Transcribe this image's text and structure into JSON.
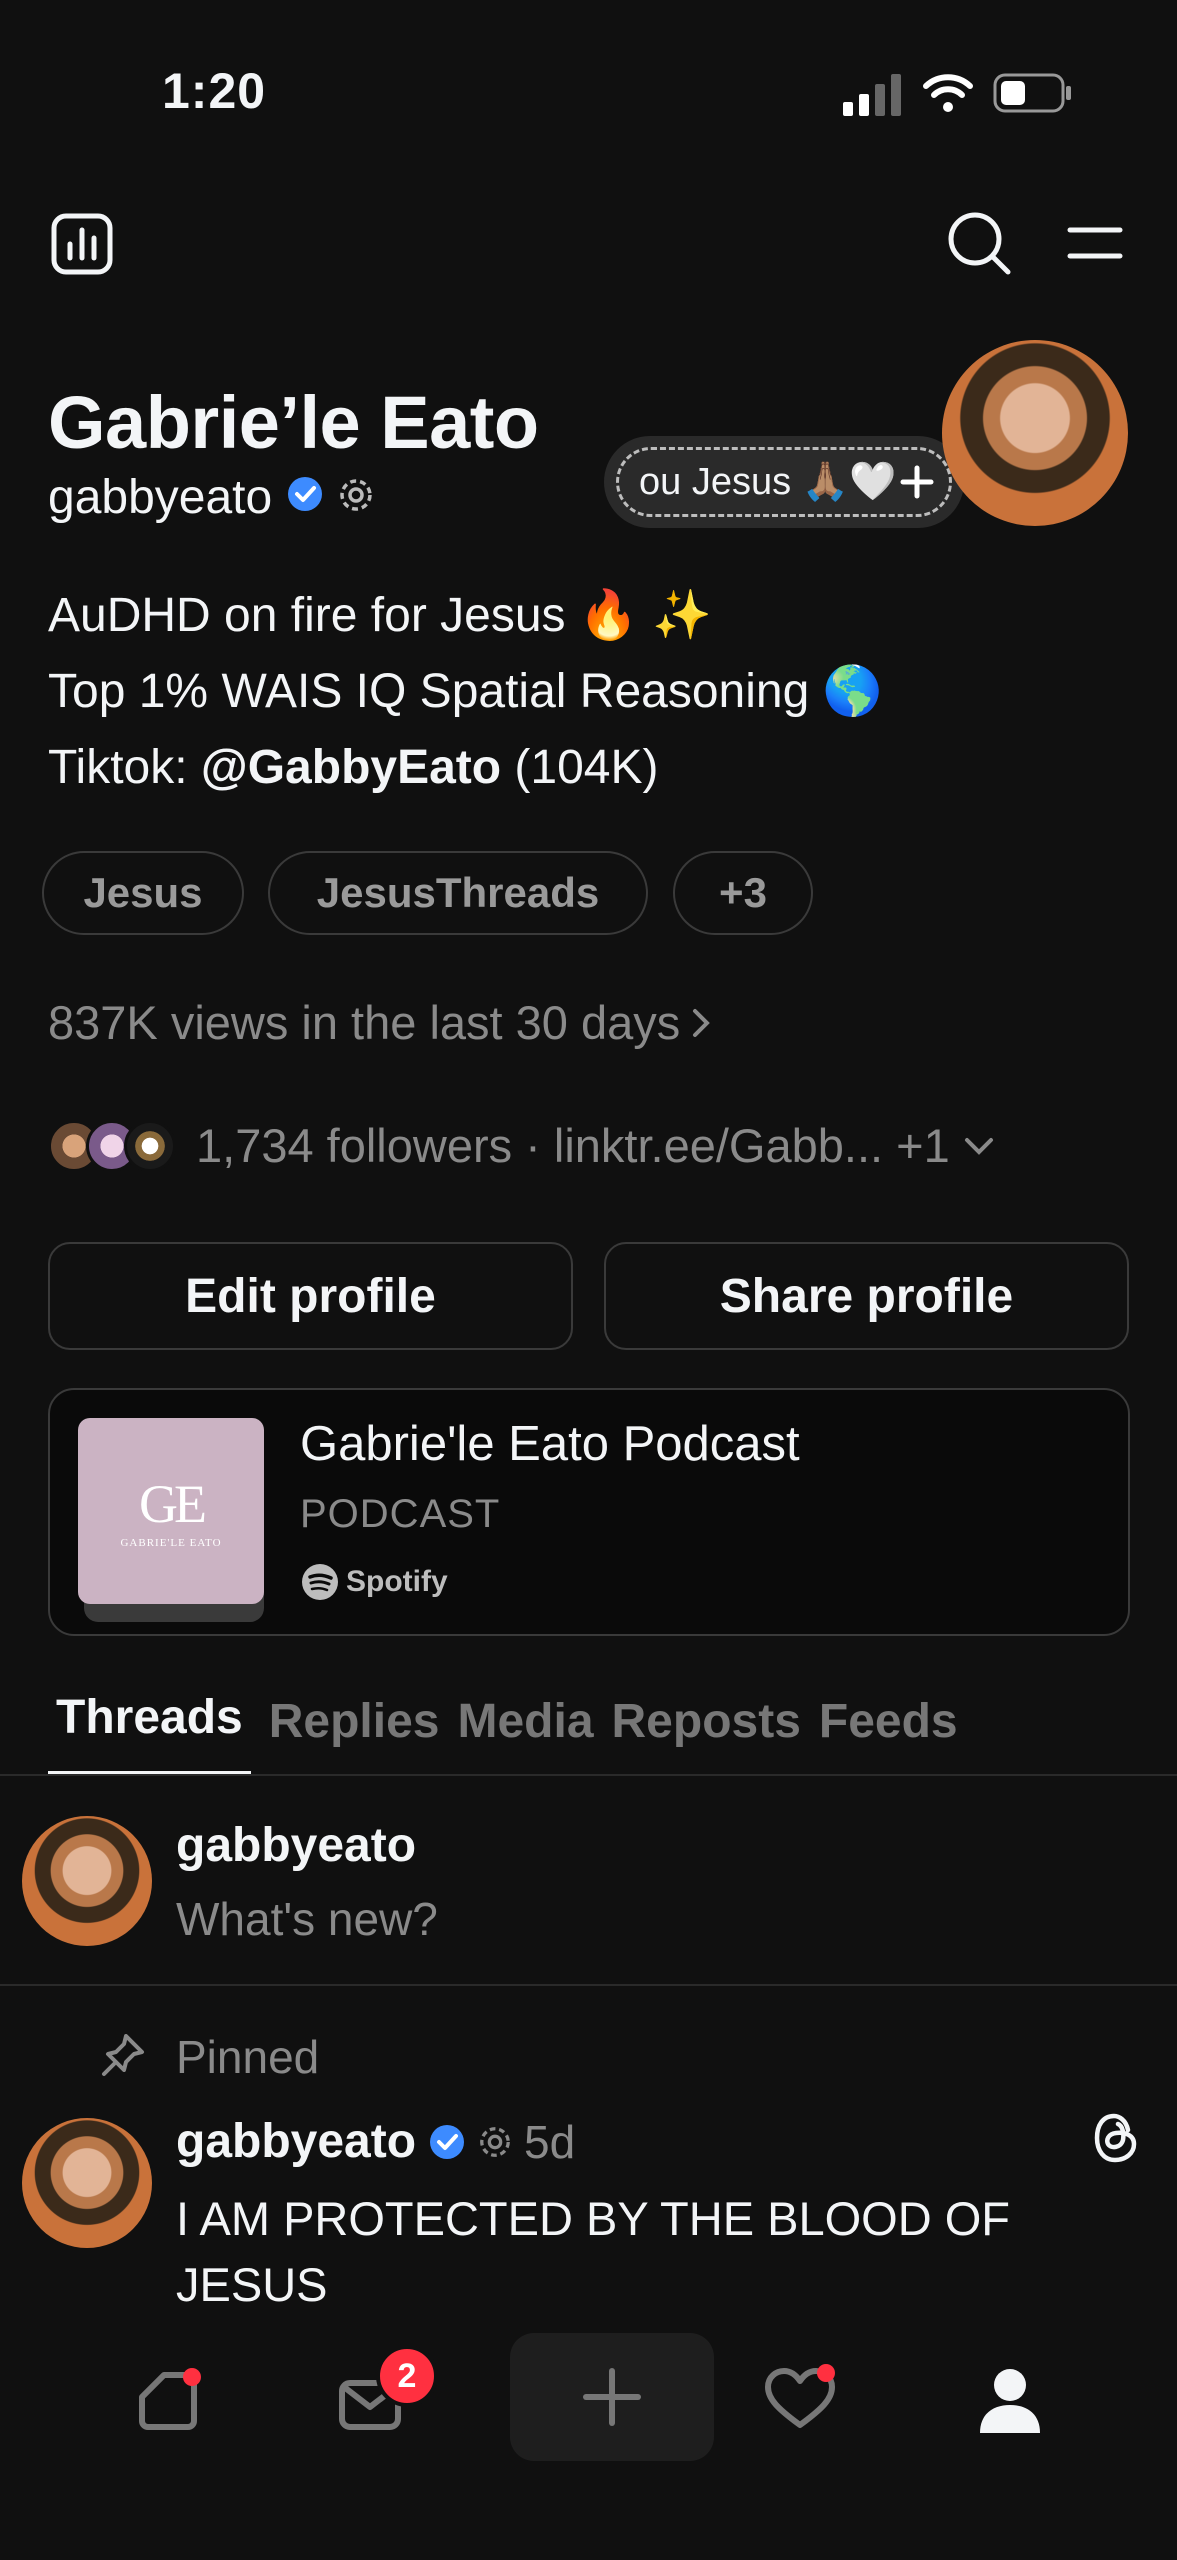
{
  "status_bar": {
    "time": "1:20"
  },
  "profile": {
    "display_name": "Gabrie’le Eato",
    "handle": "gabbyeato",
    "note_text": "ou Jesus 🙏🏽🤍",
    "bio_line1": "AuDHD on fire for Jesus 🔥 ✨",
    "bio_line2": "Top 1% WAIS IQ Spatial Reasoning 🌎",
    "bio_line3_prefix": "Tiktok: ",
    "bio_line3_bold": "@GabbyEato",
    "bio_line3_suffix": " (104K)",
    "tags": [
      "Jesus",
      "JesusThreads",
      "+3"
    ],
    "views": "837K views in the last 30 days",
    "followers_line": "1,734 followers · linktr.ee/Gabb... +1"
  },
  "buttons": {
    "edit_profile": "Edit profile",
    "share_profile": "Share profile"
  },
  "podcast": {
    "title": "Gabrie'le Eato Podcast",
    "label": "PODCAST",
    "provider": "Spotify",
    "cover_initials": "GE",
    "cover_subtitle": "GABRIE'LE EATO"
  },
  "tabs": [
    "Threads",
    "Replies",
    "Media",
    "Reposts",
    "Feeds"
  ],
  "composer": {
    "username": "gabbyeato",
    "placeholder": "What's new?"
  },
  "post": {
    "pinned_label": "Pinned",
    "username": "gabbyeato",
    "time": "5d",
    "text": "I AM PROTECTED BY THE BLOOD OF JESUS"
  },
  "nav": {
    "messages_badge": "2"
  },
  "colors": {
    "background": "#101010",
    "verified": "#3d8bff",
    "notification": "#ff3040"
  }
}
